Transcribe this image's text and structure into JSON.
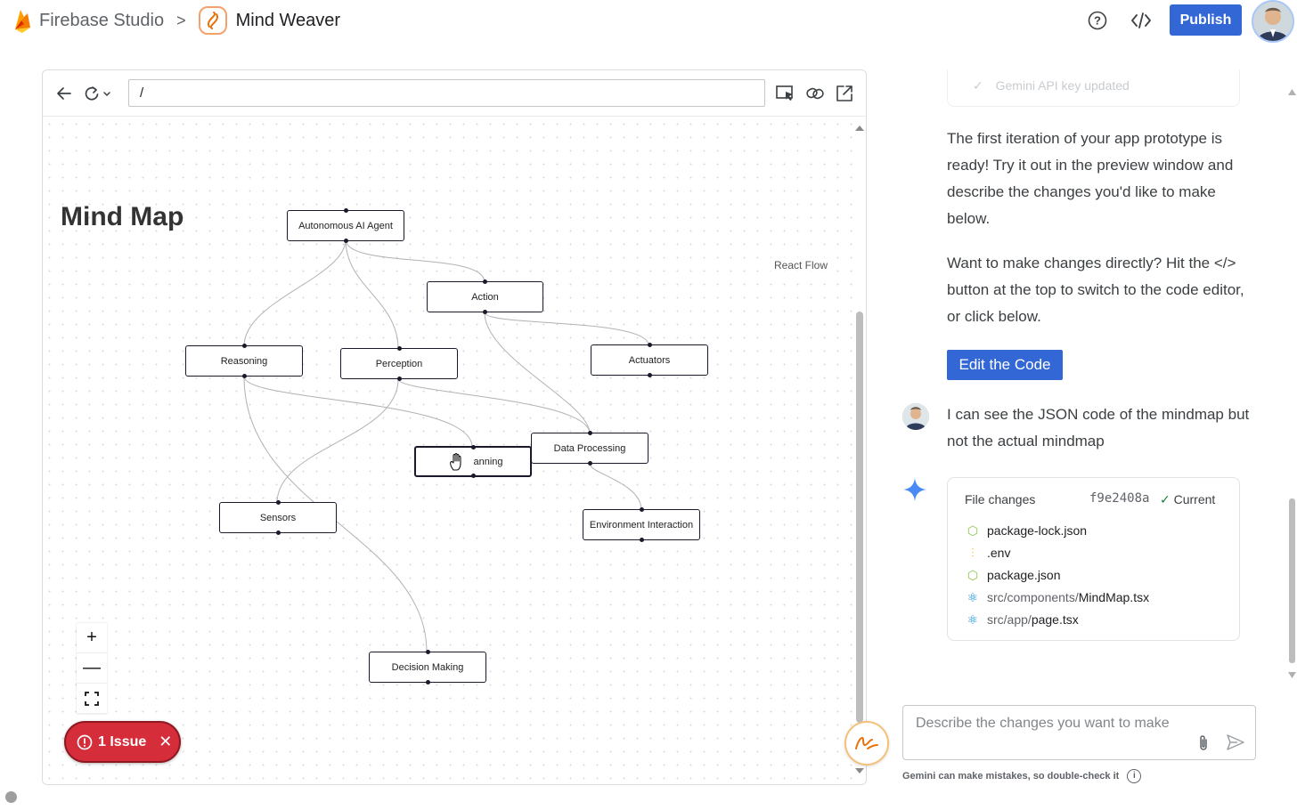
{
  "header": {
    "app_name": "Firebase Studio",
    "breadcrumb_sep": ">",
    "project_name": "Mind Weaver",
    "help_icon": "help-circle-icon",
    "code_icon": "code-icon",
    "publish_label": "Publish"
  },
  "preview": {
    "url": "/",
    "title": "Mind Map",
    "attribution": "React Flow",
    "issue_label": "1 Issue",
    "controls": {
      "zoom_in": "+",
      "zoom_out": "—",
      "fit": "⛶"
    },
    "nodes": [
      {
        "id": "agent",
        "label": "Autonomous AI Agent"
      },
      {
        "id": "action",
        "label": "Action"
      },
      {
        "id": "reasoning",
        "label": "Reasoning"
      },
      {
        "id": "perception",
        "label": "Perception"
      },
      {
        "id": "actuators",
        "label": "Actuators"
      },
      {
        "id": "data",
        "label": "Data Processing"
      },
      {
        "id": "planning",
        "label": "anning"
      },
      {
        "id": "sensors",
        "label": "Sensors"
      },
      {
        "id": "env",
        "label": "Environment Interaction"
      },
      {
        "id": "decision",
        "label": "Decision Making"
      }
    ]
  },
  "chat": {
    "faded_status": "Gemini API key updated",
    "msg1": "The first iteration of your app prototype is ready! Try it out in the preview window and describe the changes you'd like to make below.",
    "msg2_a": "Want to make changes directly? Hit the",
    "msg2_b": "</>",
    "msg2_c": "button at the top to switch to the code editor, or click below.",
    "edit_code_label": "Edit the Code",
    "user_msg": "I can see the JSON code of the mindmap but not the actual mindmap",
    "file_changes": {
      "title": "File changes",
      "hash": "f9e2408a",
      "status": "Current",
      "files": [
        {
          "icon": "json-file-icon",
          "dir": "",
          "name": "package-lock.json"
        },
        {
          "icon": "env-file-icon",
          "dir": "",
          "name": ".env"
        },
        {
          "icon": "json-file-icon",
          "dir": "",
          "name": "package.json"
        },
        {
          "icon": "react-file-icon",
          "dir": "src/components/",
          "name": "MindMap.tsx"
        },
        {
          "icon": "react-file-icon",
          "dir": "src/app/",
          "name": "page.tsx"
        }
      ]
    },
    "input_placeholder": "Describe the changes you want to make",
    "disclaimer": "Gemini can make mistakes, so double-check it"
  },
  "colors": {
    "primary": "#3367d6",
    "issue": "#d62d3a",
    "firebase_orange": "#f57c00"
  }
}
